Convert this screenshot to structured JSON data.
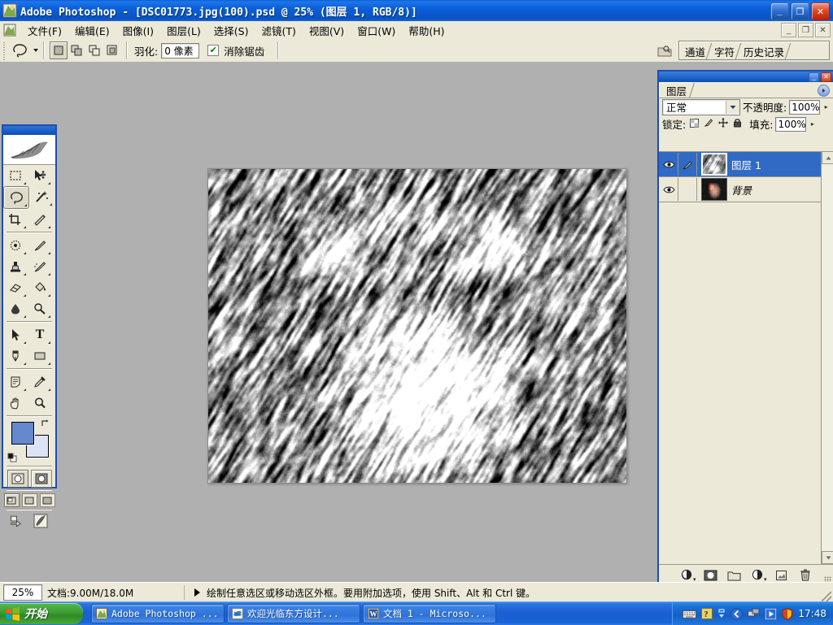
{
  "titlebar": {
    "title": "Adobe Photoshop - [DSC01773.jpg(100).psd @ 25% (图层 1, RGB/8)]",
    "minimize": "_",
    "restore": "❐",
    "close": "✕",
    "icon": "photoshop-icon"
  },
  "menubar": {
    "items": [
      {
        "label": "文件(F)"
      },
      {
        "label": "编辑(E)"
      },
      {
        "label": "图像(I)"
      },
      {
        "label": "图层(L)"
      },
      {
        "label": "选择(S)"
      },
      {
        "label": "滤镜(T)"
      },
      {
        "label": "视图(V)"
      },
      {
        "label": "窗口(W)"
      },
      {
        "label": "帮助(H)"
      }
    ],
    "doc_minimize": "_",
    "doc_restore": "❐",
    "doc_close": "✕"
  },
  "options_bar": {
    "tool": "lasso-tool",
    "selection_modes": [
      "new-selection",
      "add-to-selection",
      "subtract-from-selection",
      "intersect-selection"
    ],
    "active_mode_index": 0,
    "feather_label": "羽化:",
    "feather_value": "0 像素",
    "antialias_label": "消除锯齿",
    "antialias_checked": true,
    "check_mark": "✔"
  },
  "palette_well": {
    "tabs": [
      "通道",
      "字符",
      "历史记录"
    ],
    "file_browser_icon": "file-browser-icon"
  },
  "toolbox": {
    "selected_tool": "lasso",
    "tools": [
      {
        "name": "marquee-tool",
        "glyph": "▭"
      },
      {
        "name": "move-tool",
        "glyph": "✛"
      },
      {
        "name": "lasso-tool",
        "glyph": "◯"
      },
      {
        "name": "magic-wand-tool",
        "glyph": "✸"
      },
      {
        "name": "crop-tool",
        "glyph": "⌗"
      },
      {
        "name": "slice-tool",
        "glyph": "✂"
      },
      {
        "name": "healing-brush-tool",
        "glyph": "✱"
      },
      {
        "name": "brush-tool",
        "glyph": "✎"
      },
      {
        "name": "clone-stamp-tool",
        "glyph": "⚿"
      },
      {
        "name": "history-brush-tool",
        "glyph": "✐"
      },
      {
        "name": "eraser-tool",
        "glyph": "▰"
      },
      {
        "name": "gradient-tool",
        "glyph": "◨"
      },
      {
        "name": "blur-tool",
        "glyph": "💧"
      },
      {
        "name": "dodge-tool",
        "glyph": "◔"
      },
      {
        "name": "path-selection-tool",
        "glyph": "➤"
      },
      {
        "name": "type-tool",
        "glyph": "T"
      },
      {
        "name": "pen-tool",
        "glyph": "✒"
      },
      {
        "name": "shape-tool",
        "glyph": "▬"
      },
      {
        "name": "notes-tool",
        "glyph": "🗎"
      },
      {
        "name": "eyedropper-tool",
        "glyph": "⌇"
      },
      {
        "name": "hand-tool",
        "glyph": "✋"
      },
      {
        "name": "zoom-tool",
        "glyph": "🔍"
      }
    ],
    "foreground_color": "#6688cc",
    "background_color": "#dce3f5",
    "swap_glyph": "⇄",
    "quickmask_modes": [
      "standard-mode",
      "quick-mask-mode"
    ],
    "screen_modes": [
      "standard-screen-mode",
      "full-screen-with-menubar",
      "full-screen-mode"
    ],
    "jump_to_imageready": "jump-to-imageready"
  },
  "layers_palette": {
    "tab": "图层",
    "minimize": "_",
    "close": "✕",
    "menu_glyph": "▸",
    "blend_mode": "正常",
    "opacity_label": "不透明度:",
    "opacity_value": "100%",
    "lock_label": "锁定:",
    "lock_icons": [
      "lock-transparency-icon",
      "lock-image-icon",
      "lock-position-icon",
      "lock-all-icon"
    ],
    "fill_label": "填充:",
    "fill_value": "100%",
    "layers": [
      {
        "name": "图层 1",
        "selected": true,
        "visible": true,
        "has_brush": true,
        "locked": false
      },
      {
        "name": "背景",
        "selected": false,
        "visible": true,
        "has_brush": false,
        "locked": true
      }
    ],
    "footer_buttons": [
      {
        "name": "layer-style-button",
        "glyph": "◑"
      },
      {
        "name": "add-layer-mask-button",
        "glyph": "◙"
      },
      {
        "name": "new-group-button",
        "glyph": "▱"
      },
      {
        "name": "new-adjustment-layer-button",
        "glyph": "◕"
      },
      {
        "name": "new-layer-button",
        "glyph": "▣"
      },
      {
        "name": "delete-layer-button",
        "glyph": "🗑"
      }
    ]
  },
  "statusbar": {
    "zoom": "25%",
    "doc_info": "文档:9.00M/18.0M",
    "hint": "绘制任意选区或移动选区外框。要用附加选项，使用 Shift、Alt 和 Ctrl 键。"
  },
  "taskbar": {
    "start_label": "开始",
    "tasks": [
      {
        "label": "Adobe Photoshop ...",
        "icon": "photoshop-icon",
        "active": false
      },
      {
        "label": "欢迎光临东方设计...",
        "icon": "browser-icon",
        "active": false
      },
      {
        "label": "文档 1 - Microso...",
        "icon": "word-icon",
        "active": false
      }
    ],
    "tray_icons": [
      "keyboard-icon",
      "help-icon",
      "network-icon",
      "media-player-icon",
      "antivirus-icon"
    ],
    "time": "17:48"
  },
  "canvas": {
    "title": "DSC01773.jpg(100).psd",
    "zoom": "25%",
    "description": "grayscale motion-blurred noise snow texture"
  }
}
